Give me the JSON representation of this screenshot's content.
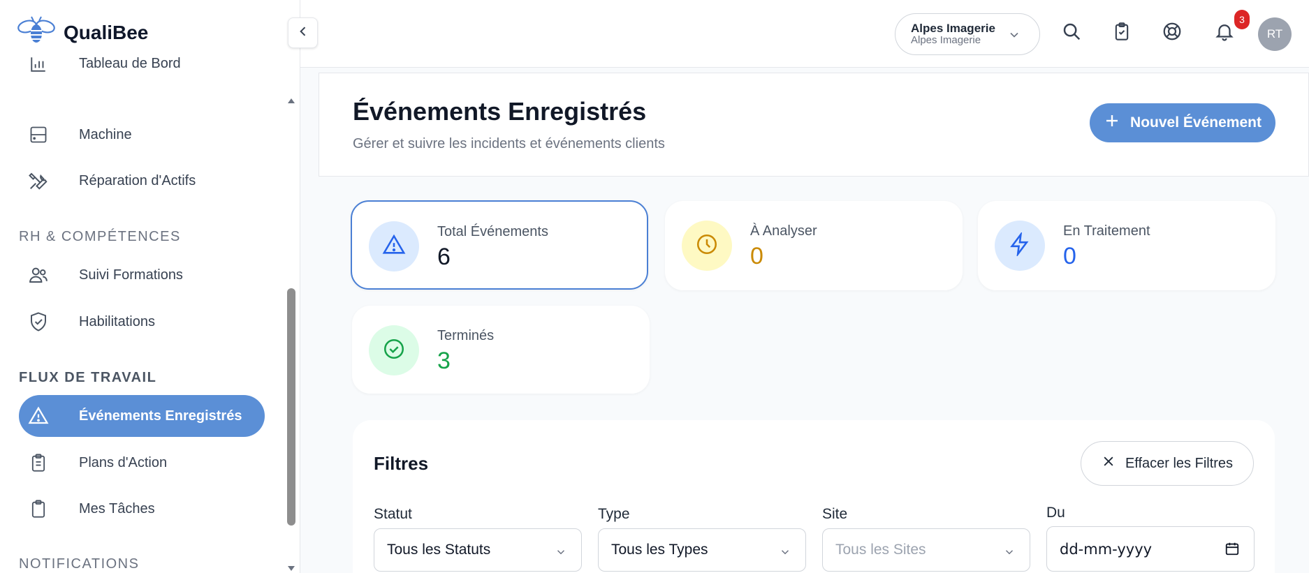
{
  "brand": {
    "name": "QualiBee"
  },
  "sidebar": {
    "partial_item": "Tableau de Bord",
    "items_top": [
      {
        "label": "Machine",
        "icon": "server-icon"
      },
      {
        "label": "Réparation d'Actifs",
        "icon": "tools-icon"
      }
    ],
    "section_hr": "RH & COMPÉTENCES",
    "items_hr": [
      {
        "label": "Suivi Formations",
        "icon": "users-icon"
      },
      {
        "label": "Habilitations",
        "icon": "shield-check-icon"
      }
    ],
    "section_workflow": "FLUX DE TRAVAIL",
    "items_workflow": [
      {
        "label": "Événements Enregistrés",
        "icon": "alert-triangle-icon",
        "active": true
      },
      {
        "label": "Plans d'Action",
        "icon": "clipboard-list-icon"
      },
      {
        "label": "Mes Tâches",
        "icon": "clipboard-icon"
      }
    ],
    "section_notifications": "NOTIFICATIONS"
  },
  "topbar": {
    "org_name": "Alpes Imagerie",
    "org_sub": "Alpes Imagerie",
    "notification_count": "3",
    "avatar_initials": "RT"
  },
  "header": {
    "title": "Événements Enregistrés",
    "subtitle": "Gérer et suivre les incidents et événements clients",
    "new_button": "Nouvel Événement"
  },
  "stats": [
    {
      "label": "Total Événements",
      "value": "6",
      "color": "#111827",
      "bg": "#dbeafe",
      "icon": "alert-triangle-icon"
    },
    {
      "label": "À Analyser",
      "value": "0",
      "color": "#ca8a04",
      "bg": "#fef9c3",
      "icon": "clock-icon"
    },
    {
      "label": "En Traitement",
      "value": "0",
      "color": "#2563eb",
      "bg": "#dbeafe",
      "icon": "zap-icon"
    },
    {
      "label": "Terminés",
      "value": "3",
      "color": "#16a34a",
      "bg": "#dcfce7",
      "icon": "check-circle-icon"
    }
  ],
  "filters": {
    "title": "Filtres",
    "clear_button": "Effacer les Filtres",
    "status_label": "Statut",
    "status_value": "Tous les Statuts",
    "type_label": "Type",
    "type_value": "Tous les Types",
    "site_label": "Site",
    "site_placeholder": "Tous les Sites",
    "from_label": "Du",
    "from_value": "dd-mm-yyyy"
  }
}
